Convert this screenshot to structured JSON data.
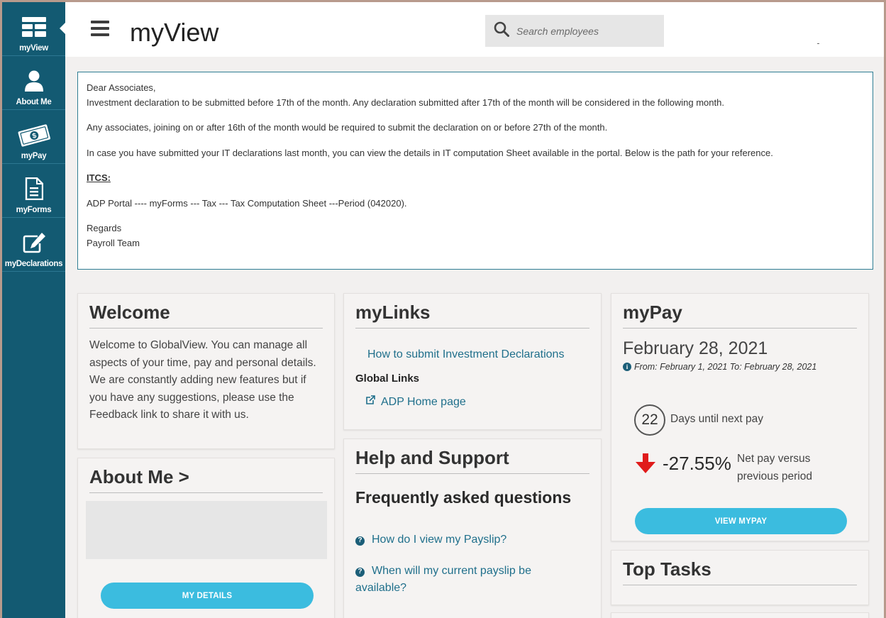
{
  "sidebar": {
    "items": [
      {
        "label": "myView",
        "icon": "dashboard-icon"
      },
      {
        "label": "About Me",
        "icon": "user-icon"
      },
      {
        "label": "myPay",
        "icon": "money-icon"
      },
      {
        "label": "myForms",
        "icon": "document-icon"
      },
      {
        "label": "myDeclarations",
        "icon": "edit-icon"
      }
    ]
  },
  "header": {
    "title": "myView",
    "search_placeholder": "Search employees"
  },
  "notice": {
    "greeting": "Dear Associates,",
    "line1": "Investment declaration to be submitted before 17th of the month. Any declaration submitted after 17th of the month will be considered in the following month.",
    "line2": "Any associates, joining on or after 16th of the month would be required to submit the declaration on or before 27th of the month.",
    "line3": "In case you have submitted your IT declarations last month, you can view the details in IT computation Sheet available in the portal. Below is the path for your reference.",
    "heading": "ITCS:",
    "path": "ADP Portal ---- myForms --- Tax --- Tax Computation Sheet  ---Period (042020).",
    "regards": "Regards",
    "team": "Payroll Team"
  },
  "welcome": {
    "title": "Welcome",
    "p1": "Welcome to GlobalView. You can manage all aspects of your time, pay and personal details.",
    "p2": "We are constantly adding new features but if you have any suggestions, please use the Feedback link to share it with us."
  },
  "about": {
    "title": "About Me >",
    "button": "MY DETAILS"
  },
  "mylinks": {
    "title": "myLinks",
    "link1": "How to submit Investment Declarations",
    "global_heading": "Global Links",
    "link2": "ADP Home page"
  },
  "help": {
    "title": "Help and Support",
    "faq_heading": "Frequently asked questions",
    "q1": "How do I view my Payslip?",
    "q2": "When will my current payslip be available?"
  },
  "mypay": {
    "title": "myPay",
    "date": "February 28, 2021",
    "range": "From: February 1, 2021 To: February 28, 2021",
    "days": "22",
    "days_label": "Days until next pay",
    "change": "-27.55%",
    "change_label_1": "Net pay versus",
    "change_label_2": "previous period",
    "button": "VIEW MYPAY"
  },
  "tasks": {
    "title": "Top Tasks"
  },
  "colors": {
    "sidebar": "#135a72",
    "accent": "#3bbcdf",
    "link": "#1f6f8b",
    "down_arrow": "#e01b1b"
  }
}
